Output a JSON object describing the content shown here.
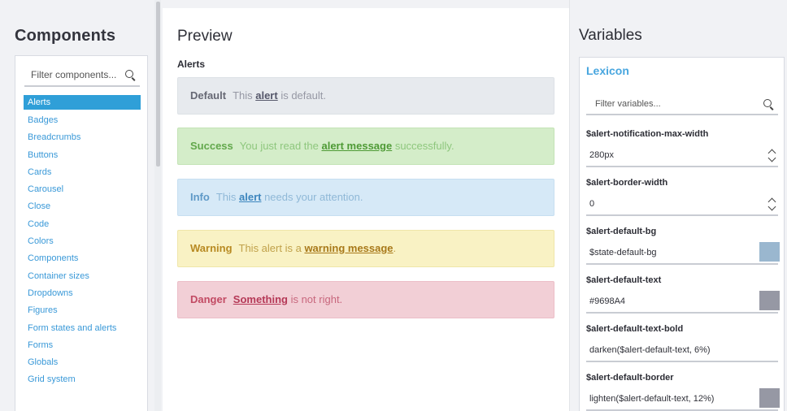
{
  "components_panel": {
    "title": "Components",
    "filter_placeholder": "Filter components...",
    "items": [
      {
        "label": "Alerts",
        "active": true
      },
      {
        "label": "Badges"
      },
      {
        "label": "Breadcrumbs"
      },
      {
        "label": "Buttons"
      },
      {
        "label": "Cards"
      },
      {
        "label": "Carousel"
      },
      {
        "label": "Close"
      },
      {
        "label": "Code"
      },
      {
        "label": "Colors"
      },
      {
        "label": "Components"
      },
      {
        "label": "Container sizes"
      },
      {
        "label": "Dropdowns"
      },
      {
        "label": "Figures"
      },
      {
        "label": "Form states and alerts"
      },
      {
        "label": "Forms"
      },
      {
        "label": "Globals"
      },
      {
        "label": "Grid system"
      }
    ]
  },
  "preview": {
    "title": "Preview",
    "section": "Alerts",
    "alerts": [
      {
        "kind": "default",
        "lead": "Default",
        "pre": "This ",
        "link": "alert",
        "post": " is default."
      },
      {
        "kind": "success",
        "lead": "Success",
        "pre": "You just read the ",
        "link": "alert message",
        "post": " successfully."
      },
      {
        "kind": "info",
        "lead": "Info",
        "pre": "This ",
        "link": "alert",
        "post": " needs your attention."
      },
      {
        "kind": "warning",
        "lead": "Warning",
        "pre": "This alert is a ",
        "link": "warning message",
        "post": "."
      },
      {
        "kind": "danger",
        "lead": "Danger",
        "pre": "",
        "link": "Something",
        "post": " is not right."
      }
    ]
  },
  "variables_panel": {
    "title": "Variables",
    "section_title": "Lexicon",
    "filter_placeholder": "Filter variables...",
    "items": [
      {
        "label": "$alert-notification-max-width",
        "value": "280px",
        "control": "spinner"
      },
      {
        "label": "$alert-border-width",
        "value": "0",
        "control": "spinner"
      },
      {
        "label": "$alert-default-bg",
        "value": "$state-default-bg",
        "control": "swatch",
        "color": "#9ab7cf"
      },
      {
        "label": "$alert-default-text",
        "value": "#9698A4",
        "control": "swatch",
        "color": "#9698a4"
      },
      {
        "label": "$alert-default-text-bold",
        "value": "darken($alert-default-text, 6%)",
        "control": "none"
      },
      {
        "label": "$alert-default-border",
        "value": "lighten($alert-default-text, 12%)",
        "control": "swatch",
        "color": "#9698a4"
      }
    ]
  }
}
